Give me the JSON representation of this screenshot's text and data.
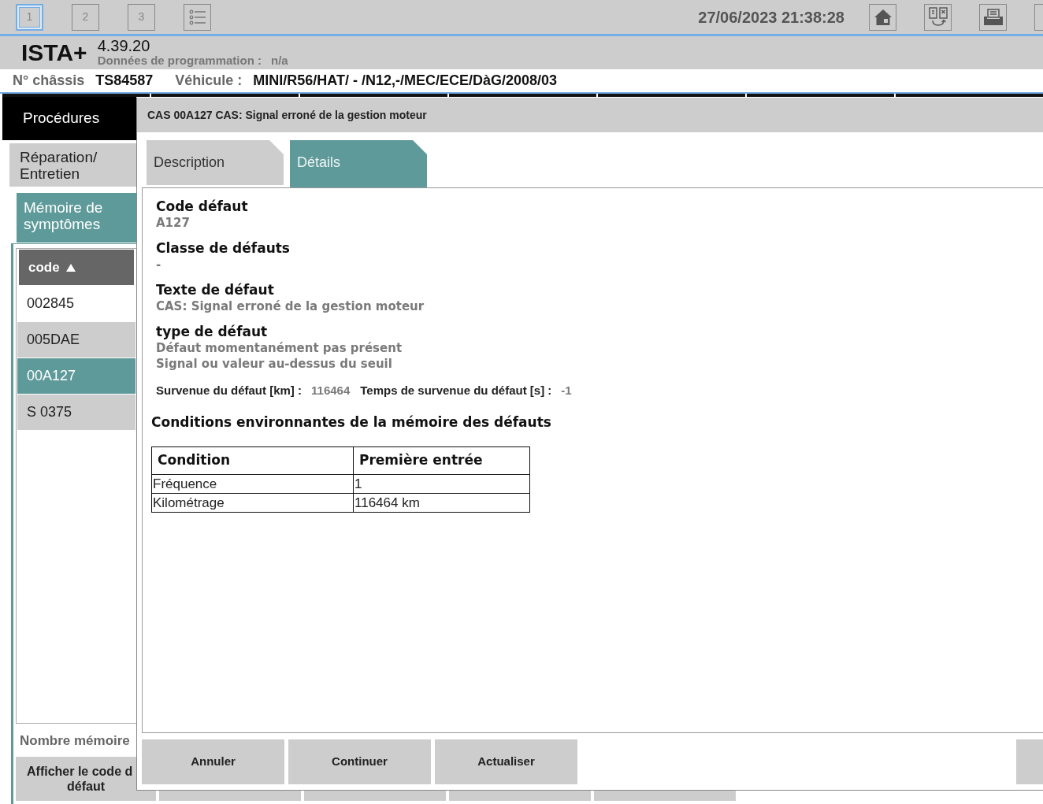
{
  "toolbar": {
    "pages": [
      {
        "label": "1",
        "selected": true
      },
      {
        "label": "2",
        "selected": false
      },
      {
        "label": "3",
        "selected": false
      }
    ],
    "datetime": "27/06/2023 21:38:28"
  },
  "app": {
    "name": "ISTA+",
    "version": "4.39.20",
    "programming_label": "Données de programmation :",
    "programming_value": "n/a"
  },
  "vehicle_bar": {
    "chassis_label": "N° châssis",
    "chassis": "TS84587",
    "vehicle_label": "Véhicule :",
    "vehicle": "MINI/R56/HAT/ - /N12,-/MEC/ECE/DàG/2008/03"
  },
  "navigation": [
    {
      "label": "Procédures",
      "children": [
        {
          "label": "Réparation/ Entretien",
          "children": [
            {
              "label": "Mémoire de symptômes"
            }
          ]
        }
      ]
    }
  ],
  "fault_list": {
    "column": "code",
    "sorted_ascending": true,
    "rows": [
      {
        "code": "002845",
        "selected": false
      },
      {
        "code": "005DAE",
        "selected": false
      },
      {
        "code": "00A127",
        "selected": true
      },
      {
        "code": "S 0375",
        "selected": false
      }
    ],
    "count_label": "Nombre mémoire",
    "action_button": [
      "Afficher le code d",
      "défaut"
    ]
  },
  "dialog": {
    "title": "CAS 00A127 CAS: Signal erroné de la gestion moteur",
    "tabs": [
      {
        "label": "Description",
        "selected": false
      },
      {
        "label": "Détails",
        "selected": true
      }
    ],
    "fields": [
      {
        "label": "Code défaut",
        "values": [
          "A127"
        ]
      },
      {
        "label": "Classe de défauts",
        "values": [
          "-"
        ]
      },
      {
        "label": "Texte de défaut",
        "values": [
          "CAS: Signal erroné de la gestion moteur"
        ]
      },
      {
        "label": "type de défaut",
        "values": [
          "Défaut momentanément pas présent",
          "Signal ou valeur au-dessus du seuil"
        ]
      }
    ],
    "occurrence": [
      {
        "label": "Survenue du défaut [km] :",
        "value": "116464"
      },
      {
        "label": "Temps de survenue du défaut [s] :",
        "value": "-1"
      }
    ],
    "conditions": {
      "title": "Conditions environnantes de la mémoire des défauts",
      "columns": [
        "Condition",
        "Première entrée"
      ],
      "rows": [
        [
          "Fréquence",
          "1"
        ],
        [
          "Kilométrage",
          "116464 km"
        ]
      ]
    },
    "buttons": [
      "Annuler",
      "Continuer",
      "Actualiser"
    ]
  }
}
